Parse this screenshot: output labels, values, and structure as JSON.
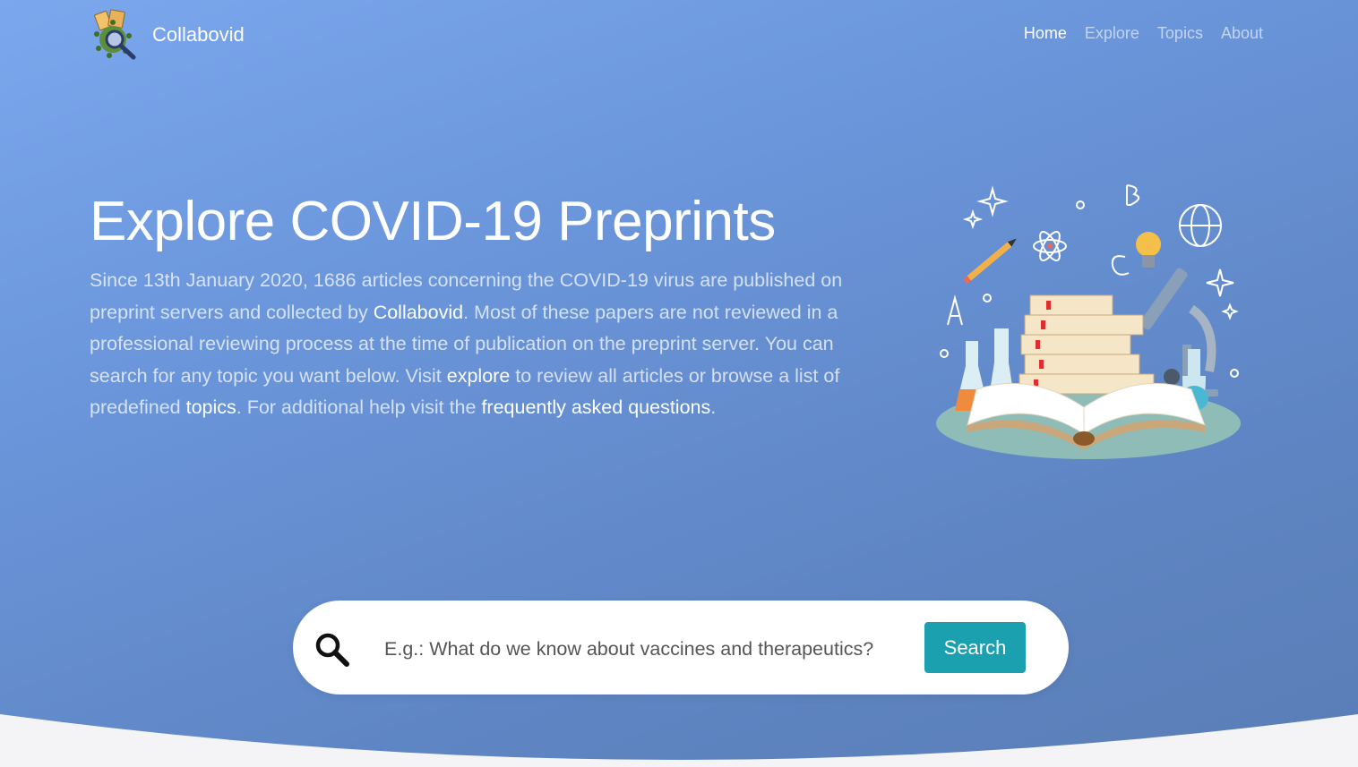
{
  "brand": {
    "name": "Collabovid",
    "logo_icon": "virus-magnifier-logo-icon"
  },
  "nav": {
    "items": [
      {
        "label": "Home",
        "active": true
      },
      {
        "label": "Explore",
        "active": false
      },
      {
        "label": "Topics",
        "active": false
      },
      {
        "label": "About",
        "active": false
      }
    ]
  },
  "hero": {
    "title": "Explore COVID-19 Preprints",
    "text": {
      "p1": "Since 13th January 2020, 1686 articles concerning the COVID-19 virus are published on preprint servers and collected by ",
      "brand": "Collabovid",
      "p2": ". Most of these papers are not reviewed in a professional reviewing process at the time of publication on the preprint server. You can search for any topic you want below. Visit ",
      "explore_link": "explore",
      "p3": " to review all articles or browse a list of predefined ",
      "topics_link": "topics",
      "p4": ". For additional help visit the ",
      "faq_link": "frequently asked questions",
      "p5": "."
    },
    "illustration_icon": "books-science-illustration-icon"
  },
  "search": {
    "placeholder": "E.g.: What do we know about vaccines and therapeutics?",
    "value": "",
    "button_label": "Search",
    "icon": "search-icon"
  },
  "colors": {
    "gradient_start": "#7ba7ee",
    "gradient_end": "#5a7db5",
    "search_button": "#1ba0b0",
    "wave": "#f4f4f6"
  }
}
